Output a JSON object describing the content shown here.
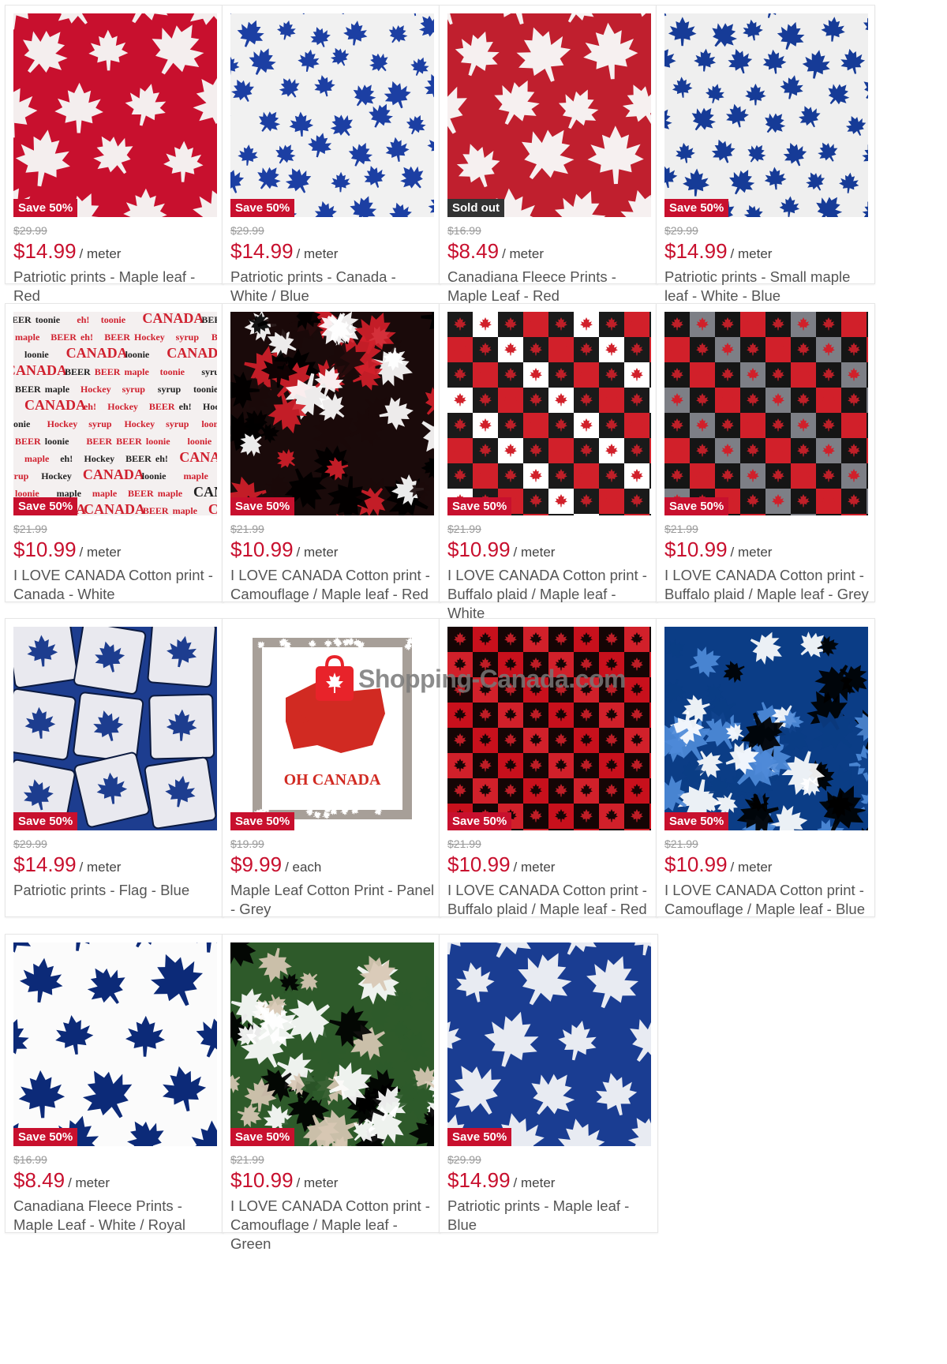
{
  "watermark": "Shopping-Canada.com",
  "colors": {
    "accent": "#c8102e",
    "sold_badge": "#333333"
  },
  "products": [
    {
      "badge": "Save 50%",
      "old_price": "$29.99",
      "price": "$14.99",
      "unit": "/ meter",
      "title": "Patriotic prints - Maple leaf - Red",
      "pattern": "leaves",
      "bg": "#c8102e",
      "fg": "#f4eeee"
    },
    {
      "badge": "Save 50%",
      "old_price": "$29.99",
      "price": "$14.99",
      "unit": "/ meter",
      "title": "Patriotic prints - Canada - White / Blue",
      "pattern": "leaves-small",
      "bg": "#f1f1f1",
      "fg": "#1c3fa3"
    },
    {
      "badge": "Sold out",
      "old_price": "$16.99",
      "price": "$8.49",
      "unit": "/ meter",
      "title": "Canadiana Fleece Prints - Maple Leaf - Red",
      "pattern": "leaves",
      "bg": "#c01f2e",
      "fg": "#f6f0f0"
    },
    {
      "badge": "Save 50%",
      "old_price": "$29.99",
      "price": "$14.99",
      "unit": "/ meter",
      "title": "Patriotic prints - Small maple leaf - White - Blue",
      "pattern": "leaves-small",
      "bg": "#efefef",
      "fg": "#163b97"
    },
    {
      "badge": "Save 50%",
      "old_price": "$21.99",
      "price": "$10.99",
      "unit": "/ meter",
      "title": "I LOVE CANADA Cotton print - Canada - White",
      "pattern": "words",
      "bg": "#f4f0f0",
      "fg": "#d0212f"
    },
    {
      "badge": "Save 50%",
      "old_price": "$21.99",
      "price": "$10.99",
      "unit": "/ meter",
      "title": "I LOVE CANADA Cotton print - Camouflage / Maple leaf - Red",
      "pattern": "camo",
      "bg": "#1a0a0a",
      "fg": "#d11f2a"
    },
    {
      "badge": "Save 50%",
      "old_price": "$21.99",
      "price": "$10.99",
      "unit": "/ meter",
      "title": "I LOVE CANADA Cotton print - Buffalo plaid / Maple leaf - White",
      "pattern": "plaid",
      "bg": "#ffffff",
      "fg": "#1a1a1a"
    },
    {
      "badge": "Save 50%",
      "old_price": "$21.99",
      "price": "$10.99",
      "unit": "/ meter",
      "title": "I LOVE CANADA Cotton print - Buffalo plaid / Maple leaf - Grey",
      "pattern": "plaid",
      "bg": "#7d7f86",
      "fg": "#151515"
    },
    {
      "badge": "Save 50%",
      "old_price": "$29.99",
      "price": "$14.99",
      "unit": "/ meter",
      "title": "Patriotic prints - Flag - Blue",
      "pattern": "flags",
      "bg": "#1d3d8f",
      "fg": "#e9e9ef"
    },
    {
      "badge": "Save 50%",
      "old_price": "$19.99",
      "price": "$9.99",
      "unit": "/ each",
      "title": "Maple Leaf Cotton Print - Panel - Grey",
      "pattern": "panel",
      "bg": "#ffffff",
      "fg": "#d12a22",
      "panel_text": "OH CANADA"
    },
    {
      "badge": "Save 50%",
      "old_price": "$21.99",
      "price": "$10.99",
      "unit": "/ meter",
      "title": "I LOVE CANADA Cotton print - Buffalo plaid / Maple leaf - Red",
      "pattern": "plaid",
      "bg": "#c8101c",
      "fg": "#150505"
    },
    {
      "badge": "Save 50%",
      "old_price": "$21.99",
      "price": "$10.99",
      "unit": "/ meter",
      "title": "I LOVE CANADA Cotton print - Camouflage / Maple leaf - Blue",
      "pattern": "camo",
      "bg": "#0b3d86",
      "fg": "#4e8ad8"
    },
    {
      "badge": "Save 50%",
      "old_price": "$16.99",
      "price": "$8.49",
      "unit": "/ meter",
      "title": "Canadiana Fleece Prints - Maple Leaf - White / Royal",
      "pattern": "leaves",
      "bg": "#fbfbfb",
      "fg": "#0c2a78"
    },
    {
      "badge": "Save 50%",
      "old_price": "$21.99",
      "price": "$10.99",
      "unit": "/ meter",
      "title": "I LOVE CANADA Cotton print - Camouflage / Maple leaf - Green",
      "pattern": "camo",
      "bg": "#2e5a2a",
      "fg": "#d8c8b4"
    },
    {
      "badge": "Save 50%",
      "old_price": "$29.99",
      "price": "$14.99",
      "unit": "/ meter",
      "title": "Patriotic prints - Maple leaf - Blue",
      "pattern": "leaves",
      "bg": "#1a3d92",
      "fg": "#e8ebf2"
    }
  ]
}
